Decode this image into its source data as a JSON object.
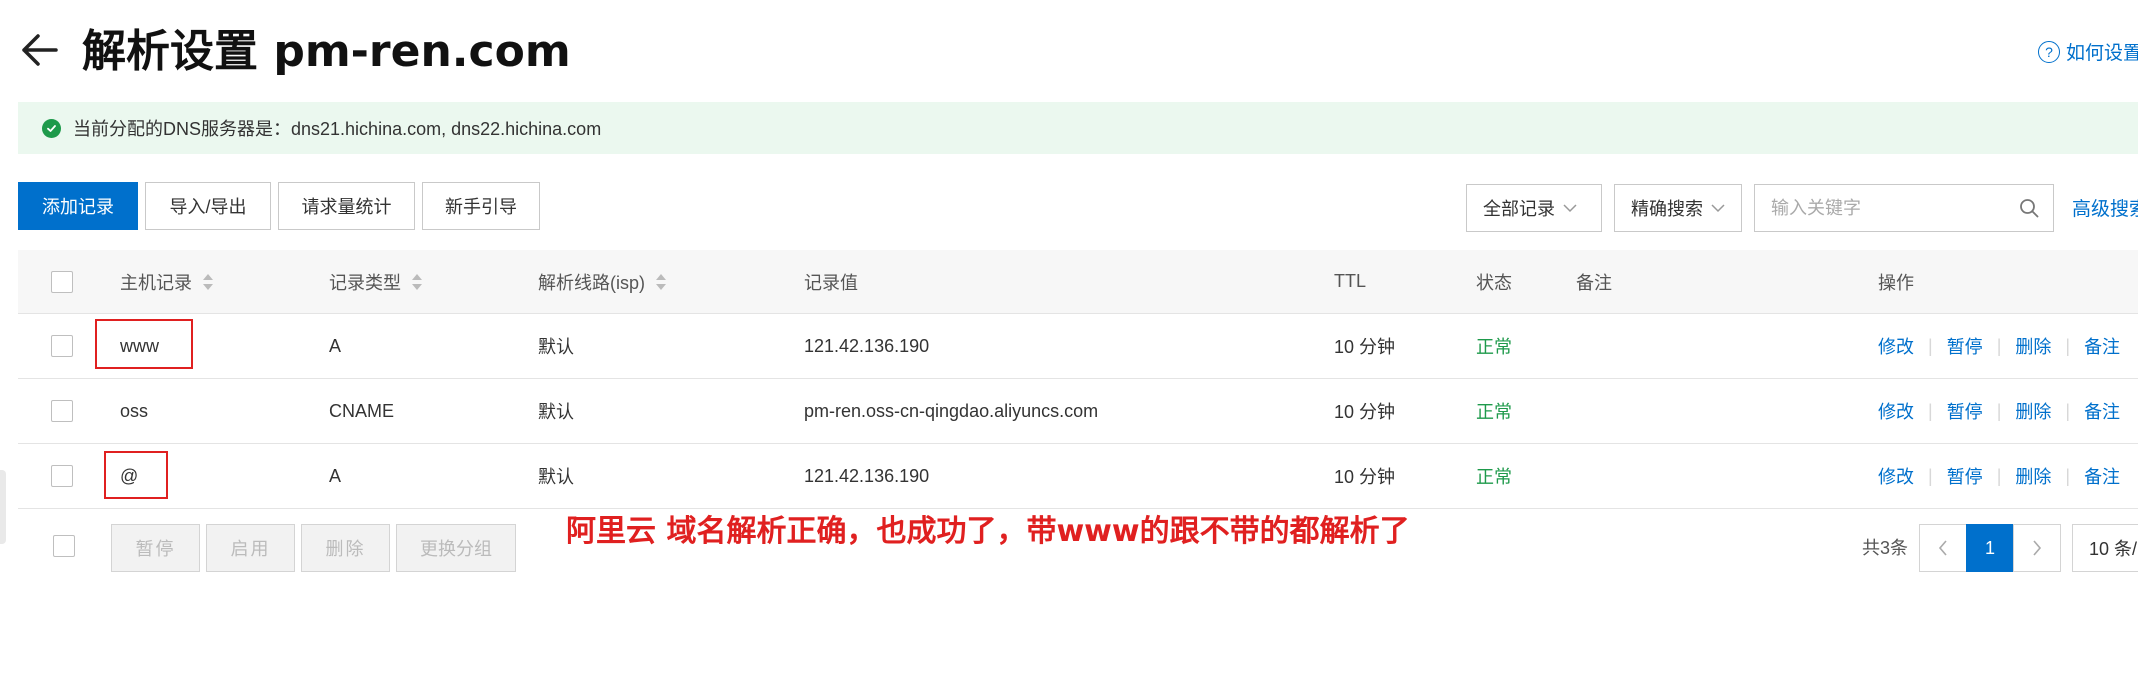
{
  "header": {
    "title": "解析设置 pm-ren.com",
    "help_label": "如何设置"
  },
  "dns_bar": {
    "text": "当前分配的DNS服务器是：dns21.hichina.com, dns22.hichina.com"
  },
  "toolbar": {
    "add_record": "添加记录",
    "import_export": "导入/导出",
    "request_stats": "请求量统计",
    "guide": "新手引导",
    "record_filter": "全部记录",
    "search_mode": "精确搜索",
    "search_placeholder": "输入关键字",
    "advanced_search": "高级搜索"
  },
  "table": {
    "headers": {
      "host": "主机记录",
      "type": "记录类型",
      "line": "解析线路(isp)",
      "value": "记录值",
      "ttl": "TTL",
      "status": "状态",
      "remark": "备注",
      "ops": "操作"
    },
    "rows": [
      {
        "host": "www",
        "type": "A",
        "line": "默认",
        "value": "121.42.136.190",
        "ttl": "10 分钟",
        "status": "正常"
      },
      {
        "host": "oss",
        "type": "CNAME",
        "line": "默认",
        "value": "pm-ren.oss-cn-qingdao.aliyuncs.com",
        "ttl": "10 分钟",
        "status": "正常"
      },
      {
        "host": "@",
        "type": "A",
        "line": "默认",
        "value": "121.42.136.190",
        "ttl": "10 分钟",
        "status": "正常"
      }
    ],
    "ops": {
      "edit": "修改",
      "pause": "暂停",
      "delete": "删除",
      "remark": "备注"
    }
  },
  "bottom": {
    "pause": "暂停",
    "enable": "启用",
    "delete": "删除",
    "change_group": "更换分组",
    "total": "共3条",
    "current_page": "1",
    "page_size": "10 条/",
    "prev": "<",
    "next": ">"
  },
  "annotation": "阿里云 域名解析正确，也成功了，带www的跟不带的都解析了",
  "colors": {
    "primary": "#0070cc",
    "success": "#1e9a4b",
    "annotation": "#e02020",
    "dns_bar_bg": "#ebf8ef"
  },
  "icons": [
    "back-arrow-icon",
    "help-icon",
    "check-circle-icon",
    "search-icon",
    "chevron-down-icon",
    "sort-icon"
  ]
}
